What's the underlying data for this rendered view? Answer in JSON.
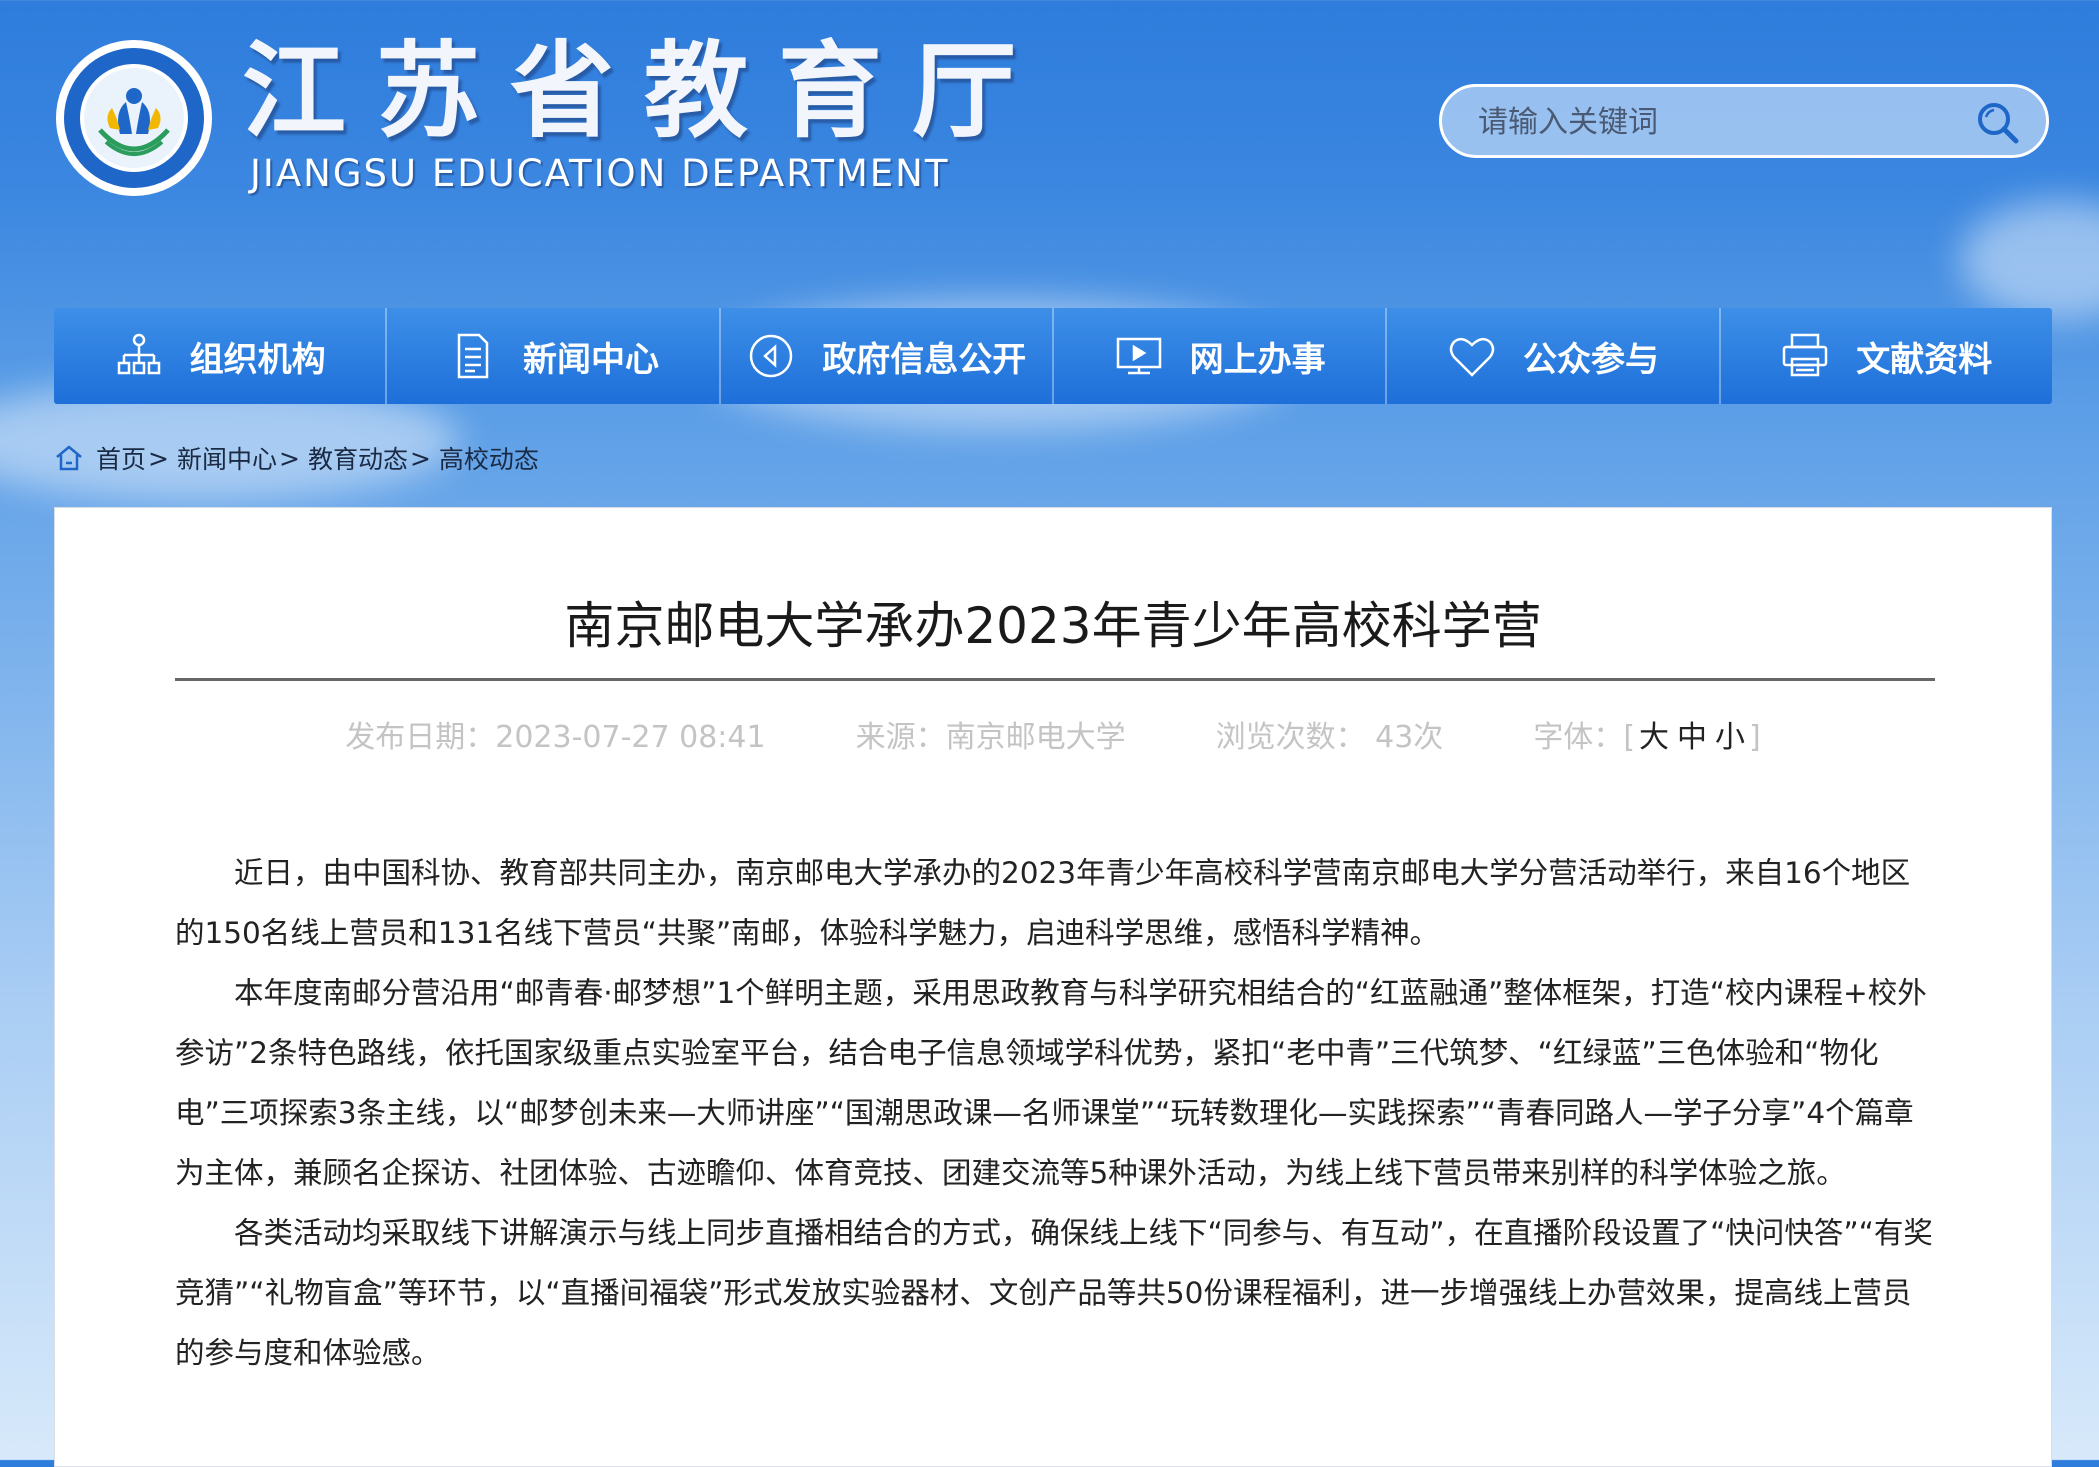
{
  "header": {
    "title_cn": "江苏省教育厅",
    "title_en": "JIANGSU EDUCATION DEPARTMENT"
  },
  "search": {
    "placeholder": "请输入关键词"
  },
  "nav": [
    {
      "label": "组织机构",
      "icon": "org-chart-icon"
    },
    {
      "label": "新闻中心",
      "icon": "document-icon"
    },
    {
      "label": "政府信息公开",
      "icon": "play-circle-icon"
    },
    {
      "label": "网上办事",
      "icon": "monitor-icon"
    },
    {
      "label": "公众参与",
      "icon": "heart-icon"
    },
    {
      "label": "文献资料",
      "icon": "printer-icon"
    }
  ],
  "breadcrumb": [
    "首页",
    "新闻中心",
    "教育动态",
    "高校动态"
  ],
  "breadcrumb_sep": ">",
  "article": {
    "title": "南京邮电大学承办2023年青少年高校科学营",
    "meta": {
      "date": "发布日期：2023-07-27 08:41",
      "source": "来源：南京邮电大学",
      "views": "浏览次数：  43次",
      "font_label": "字体：",
      "bracket_open": "[",
      "size_large": "大",
      "size_medium": "中",
      "size_small": "小",
      "bracket_close": "]"
    },
    "paragraphs": [
      "近日，由中国科协、教育部共同主办，南京邮电大学承办的2023年青少年高校科学营南京邮电大学分营活动举行，来自16个地区的150名线上营员和131名线下营员“共聚”南邮，体验科学魅力，启迪科学思维，感悟科学精神。",
      "本年度南邮分营沿用“邮青春·邮梦想”1个鲜明主题，采用思政教育与科学研究相结合的“红蓝融通”整体框架，打造“校内课程+校外参访”2条特色路线，依托国家级重点实验室平台，结合电子信息领域学科优势，紧扣“老中青”三代筑梦、“红绿蓝”三色体验和“物化电”三项探索3条主线，以“邮梦创未来—大师讲座”“国潮思政课—名师课堂”“玩转数理化—实践探索”“青春同路人—学子分享”4个篇章为主体，兼顾名企探访、社团体验、古迹瞻仰、体育竞技、团建交流等5种课外活动，为线上线下营员带来别样的科学体验之旅。",
      "各类活动均采取线下讲解演示与线上同步直播相结合的方式，确保线上线下“同参与、有互动”，在直播阶段设置了“快问快答”“有奖竞猜”“礼物盲盒”等环节，以“直播间福袋”形式发放实验器材、文创产品等共50份课程福利，进一步增强线上办营效果，提高线上营员的参与度和体验感。"
    ]
  },
  "colors": {
    "nav_bg": "#2a7be0",
    "header_bg": "#2e7cdc",
    "text": "#222222",
    "meta_text": "#c4c4c4"
  }
}
